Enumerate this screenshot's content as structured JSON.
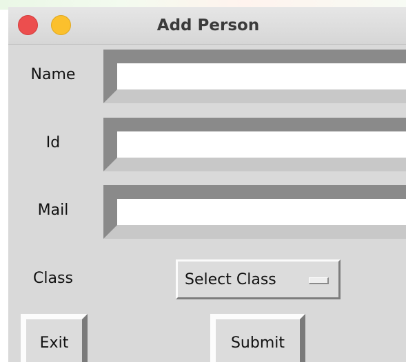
{
  "window": {
    "title": "Add Person"
  },
  "form": {
    "name_label": "Name",
    "name_value": "",
    "id_label": "Id",
    "id_value": "",
    "mail_label": "Mail",
    "mail_value": "",
    "class_label": "Class",
    "class_selected": "Select Class"
  },
  "buttons": {
    "exit_label": "Exit",
    "submit_label": "Submit"
  },
  "colors": {
    "window_bg": "#d9d9d9",
    "close_button": "#ec4e4e",
    "minimize_button": "#fbc02d"
  }
}
